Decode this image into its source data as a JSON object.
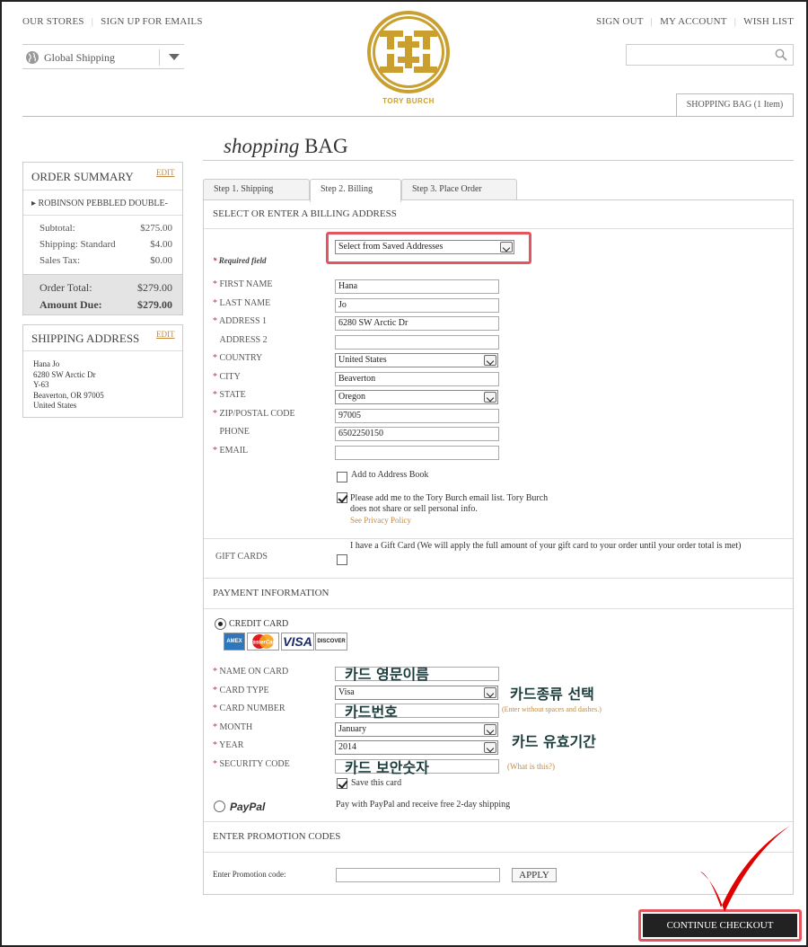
{
  "header": {
    "left_links": [
      "OUR STORES",
      "SIGN UP FOR EMAILS"
    ],
    "right_links": [
      "SIGN OUT",
      "MY ACCOUNT",
      "WISH LIST"
    ],
    "global_shipping": "Global Shipping",
    "logo_text": "TORY BURCH",
    "shopping_bag": "SHOPPING BAG",
    "bag_count": "(1 Item)"
  },
  "page_title": {
    "italic": "shopping",
    "rest": "BAG"
  },
  "order_summary": {
    "heading": "ORDER SUMMARY",
    "edit": "EDIT",
    "item": "ROBINSON PEBBLED DOUBLE-",
    "subtotal_label": "Subtotal:",
    "subtotal": "$275.00",
    "shipping_label": "Shipping: Standard",
    "shipping": "$4.00",
    "tax_label": "Sales Tax:",
    "tax": "$0.00",
    "order_total_label": "Order Total:",
    "order_total": "$279.00",
    "amount_due_label": "Amount Due:",
    "amount_due": "$279.00"
  },
  "shipping_address": {
    "heading": "SHIPPING ADDRESS",
    "edit": "EDIT",
    "lines": [
      "Hana Jo",
      "6280 SW Arctic Dr",
      "Y-63",
      "Beaverton, OR 97005",
      "United States"
    ]
  },
  "tabs": [
    "Step 1. Shipping",
    "Step 2. Billing",
    "Step 3. Place Order"
  ],
  "billing": {
    "heading": "SELECT OR ENTER A BILLING ADDRESS",
    "saved_select": "Select from Saved Addresses",
    "required": "Required field",
    "fields": [
      {
        "label": "FIRST NAME",
        "value": "Hana",
        "required": true,
        "type": "input"
      },
      {
        "label": "LAST NAME",
        "value": "Jo",
        "required": true,
        "type": "input"
      },
      {
        "label": "ADDRESS 1",
        "value": "6280 SW Arctic Dr",
        "required": true,
        "type": "input"
      },
      {
        "label": "ADDRESS 2",
        "value": "",
        "required": false,
        "type": "input"
      },
      {
        "label": "COUNTRY",
        "value": "United States",
        "required": true,
        "type": "select"
      },
      {
        "label": "CITY",
        "value": "Beaverton",
        "required": true,
        "type": "input"
      },
      {
        "label": "STATE",
        "value": "Oregon",
        "required": true,
        "type": "select"
      },
      {
        "label": "ZIP/POSTAL CODE",
        "value": "97005",
        "required": true,
        "type": "input"
      },
      {
        "label": "PHONE",
        "value": "6502250150",
        "required": false,
        "type": "input"
      },
      {
        "label": "EMAIL",
        "value": "",
        "required": true,
        "type": "input"
      }
    ],
    "add_book": "Add to Address Book",
    "email_opt1": "Please add me to the Tory Burch email list. Tory Burch",
    "email_opt2": "does not share or sell personal info.",
    "privacy": "See Privacy Policy"
  },
  "gift": {
    "label": "GIFT CARDS",
    "text": "I have a Gift Card (We will apply the full amount of your gift card to your order until your order total is met)"
  },
  "payment": {
    "heading": "PAYMENT INFORMATION",
    "credit_card": "CREDIT CARD",
    "cards": [
      "AMEX",
      "MasterCard",
      "VISA",
      "DISCOVER"
    ],
    "fields": [
      {
        "label": "NAME ON CARD",
        "value": "",
        "type": "input"
      },
      {
        "label": "CARD TYPE",
        "value": "Visa",
        "type": "select"
      },
      {
        "label": "CARD NUMBER",
        "value": "",
        "type": "input"
      },
      {
        "label": "MONTH",
        "value": "January",
        "type": "select"
      },
      {
        "label": "YEAR",
        "value": "2014",
        "type": "select"
      },
      {
        "label": "SECURITY CODE",
        "value": "",
        "type": "input"
      }
    ],
    "card_number_hint": "(Enter without spaces and dashes.)",
    "security_hint": "(What is this?)",
    "save_card": "Save this card",
    "paypal": "PayPal",
    "paypal_text": "Pay with PayPal and receive free 2-day shipping"
  },
  "annotations": {
    "name_on_card": "카드 영문이름",
    "card_type": "카드종류 선택",
    "card_number": "카드번호",
    "expiry": "카드 유효기간",
    "security": "카드 보안숫자"
  },
  "promo": {
    "heading": "ENTER PROMOTION CODES",
    "label": "Enter Promotion code:",
    "apply": "APPLY"
  },
  "continue": "CONTINUE CHECKOUT",
  "colors": {
    "accent": "#c48a3f",
    "highlight": "#e55560",
    "check": "#e00000",
    "logo_gold": "#c9a030"
  }
}
